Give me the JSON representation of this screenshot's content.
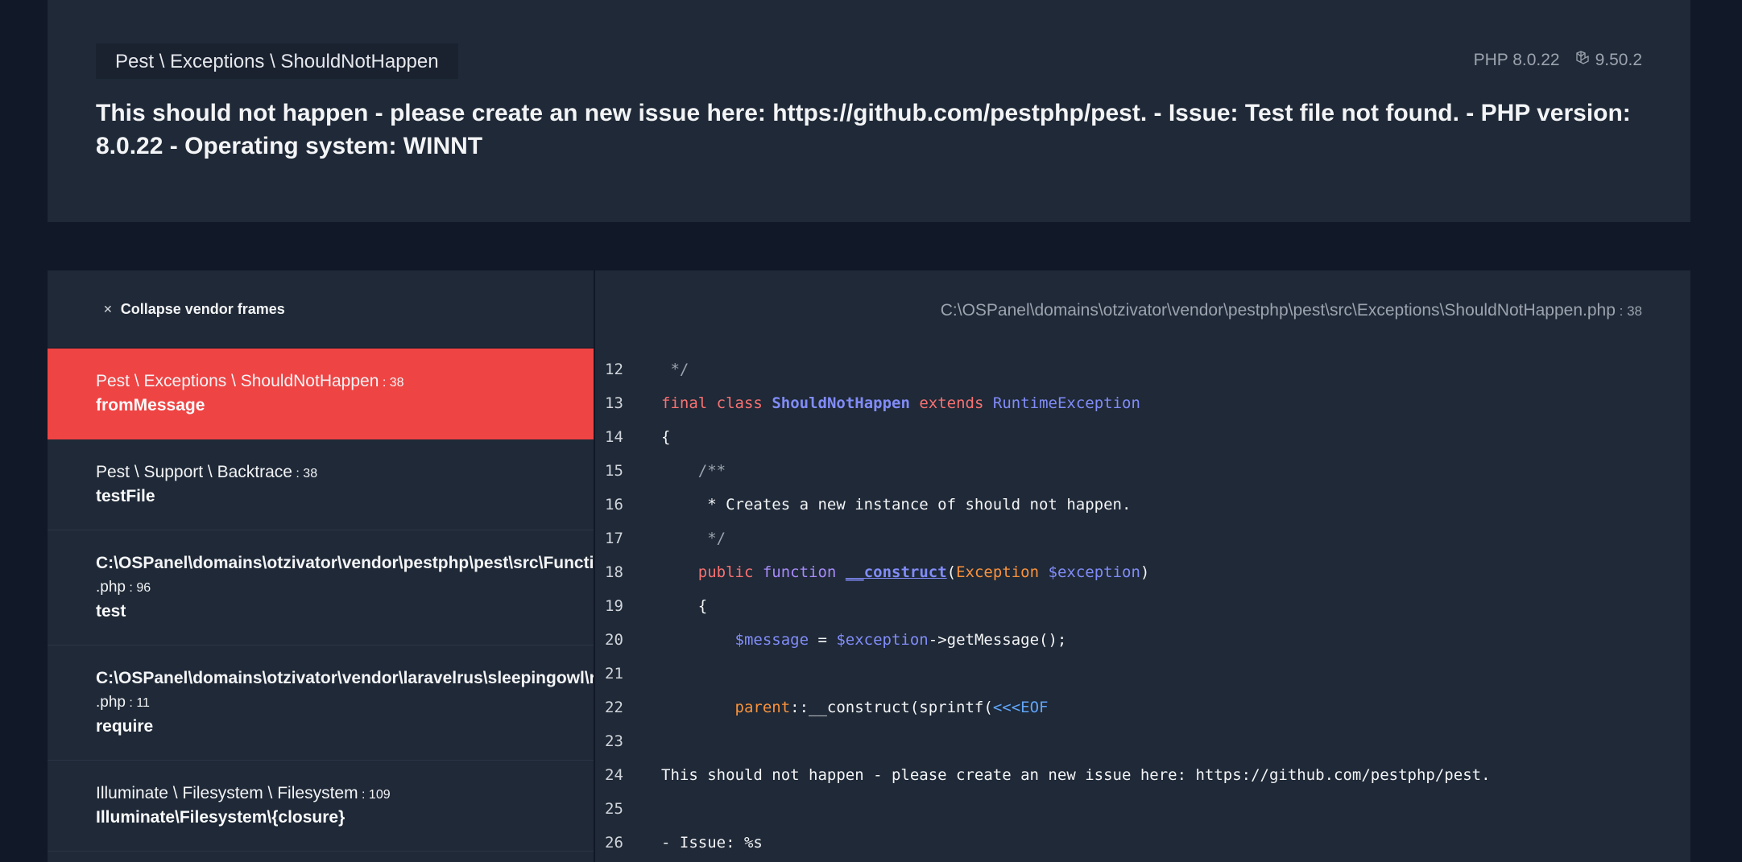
{
  "header": {
    "exception_class": "Pest \\ Exceptions \\ ShouldNotHappen",
    "php_version": "PHP 8.0.22",
    "laravel_version": "9.50.2",
    "message": "This should not happen - please create an new issue here: https://github.com/pestphp/pest. - Issue: Test file not found. - PHP version: 8.0.22 - Operating system: WINNT"
  },
  "frames_panel": {
    "collapse_label": "Collapse vendor frames",
    "frames": [
      {
        "cls": "Pest \\ Exceptions \\ ShouldNotHappen",
        "line": "38",
        "fn": "fromMessage"
      },
      {
        "cls": "Pest \\ Support \\ Backtrace",
        "line": "38",
        "fn": "testFile"
      },
      {
        "cls": "C:\\OSPanel\\domains\\otzivator\\vendor\\pestphp\\pest\\src\\Functions",
        "ext": ".php",
        "line": "96",
        "fn": "test"
      },
      {
        "cls": "C:\\OSPanel\\domains\\otzivator\\vendor\\laravelrus\\sleepingowl\\resources",
        "ext": ".php",
        "line": "11",
        "fn": "require"
      },
      {
        "cls": "Illuminate \\ Filesystem \\ Filesystem",
        "line": "109",
        "fn": "Illuminate\\Filesystem\\{closure}"
      }
    ]
  },
  "code_panel": {
    "file_path": "C:\\OSPanel\\domains\\otzivator\\vendor\\pestphp\\pest\\src\\Exceptions\\ShouldNotHappen",
    "file_ext": ".php",
    "file_line": "38",
    "line_numbers": [
      "12",
      "13",
      "14",
      "15",
      "16",
      "17",
      "18",
      "19",
      "20",
      "21",
      "22",
      "23",
      "24",
      "25",
      "26"
    ],
    "lines": {
      "l12": " */",
      "l13_final": "final",
      "l13_class": "class",
      "l13_name": "ShouldNotHappen",
      "l13_extends": "extends",
      "l13_parent": "RuntimeException",
      "l14": "{",
      "l15": "    /**",
      "l16": "     * Creates a new instance of should not happen.",
      "l17": "     */",
      "l18_public": "    public",
      "l18_function": "function",
      "l18_ctor": "__construct",
      "l18_open": "(",
      "l18_type": "Exception",
      "l18_var": "$exception",
      "l18_close": ")",
      "l19": "    {",
      "l20_var1": "        $message",
      "l20_eq": " = ",
      "l20_var2": "$exception",
      "l20_rest": "->getMessage();",
      "l21": "",
      "l22_parent": "        parent",
      "l22_rest": "::__construct(sprintf(",
      "l22_heredoc": "<<<EOF",
      "l23": "",
      "l24": "This should not happen - please create an new issue here: https://github.com/pestphp/pest.",
      "l25": "",
      "l26": "- Issue: %s"
    }
  }
}
